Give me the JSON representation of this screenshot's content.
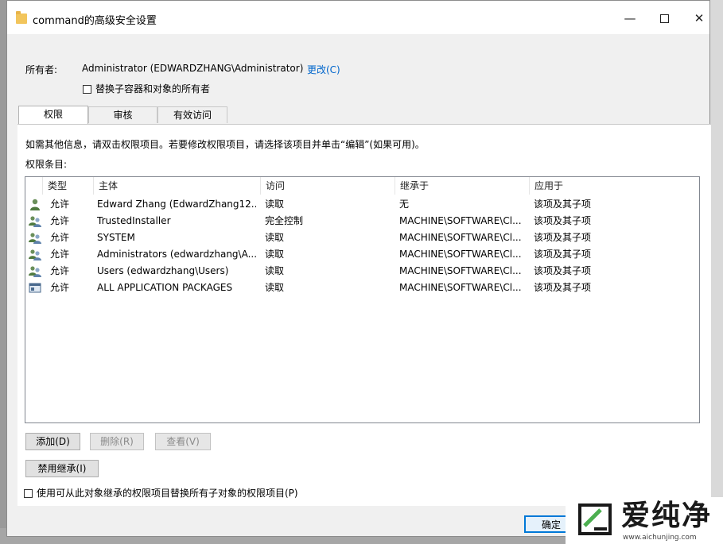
{
  "window": {
    "title": "command的高级安全设置",
    "controls": {
      "minimize": "—",
      "close": "✕"
    }
  },
  "owner": {
    "label": "所有者:",
    "value": "Administrator (EDWARDZHANG\\Administrator)",
    "change_link": "更改(C)",
    "replace_checkbox_label": "替换子容器和对象的所有者",
    "replace_checked": false
  },
  "tabs": [
    {
      "label": "权限",
      "active": true
    },
    {
      "label": "审核",
      "active": false
    },
    {
      "label": "有效访问",
      "active": false
    }
  ],
  "permissions": {
    "info_text": "如需其他信息，请双击权限项目。若要修改权限项目，请选择该项目并单击“编辑”(如果可用)。",
    "entries_label": "权限条目:",
    "columns": [
      "类型",
      "主体",
      "访问",
      "继承于",
      "应用于"
    ],
    "rows": [
      {
        "icon": "user-icon",
        "type": "允许",
        "principal": "Edward Zhang (EdwardZhang12...",
        "access": "读取",
        "inherited_from": "无",
        "applies_to": "该项及其子项"
      },
      {
        "icon": "group-icon",
        "type": "允许",
        "principal": "TrustedInstaller",
        "access": "完全控制",
        "inherited_from": "MACHINE\\SOFTWARE\\Cl...",
        "applies_to": "该项及其子项"
      },
      {
        "icon": "group-icon",
        "type": "允许",
        "principal": "SYSTEM",
        "access": "读取",
        "inherited_from": "MACHINE\\SOFTWARE\\Cl...",
        "applies_to": "该项及其子项"
      },
      {
        "icon": "group-icon",
        "type": "允许",
        "principal": "Administrators (edwardzhang\\A...",
        "access": "读取",
        "inherited_from": "MACHINE\\SOFTWARE\\Cl...",
        "applies_to": "该项及其子项"
      },
      {
        "icon": "group-icon",
        "type": "允许",
        "principal": "Users (edwardzhang\\Users)",
        "access": "读取",
        "inherited_from": "MACHINE\\SOFTWARE\\Cl...",
        "applies_to": "该项及其子项"
      },
      {
        "icon": "packages-icon",
        "type": "允许",
        "principal": "ALL APPLICATION PACKAGES",
        "access": "读取",
        "inherited_from": "MACHINE\\SOFTWARE\\Cl...",
        "applies_to": "该项及其子项"
      }
    ],
    "buttons": {
      "add": "添加(D)",
      "remove": "删除(R)",
      "view": "查看(V)",
      "disable_inheritance": "禁用继承(I)"
    },
    "replace_child_label": "使用可从此对象继承的权限项目替换所有子对象的权限项目(P)",
    "replace_child_checked": false
  },
  "footer": {
    "ok_button": "确定"
  },
  "watermark": {
    "text": "爱纯净",
    "url": "www.aichunjing.com"
  },
  "colors": {
    "link": "#0066cc",
    "accent": "#0078d7",
    "folder": "#f2c55c"
  }
}
